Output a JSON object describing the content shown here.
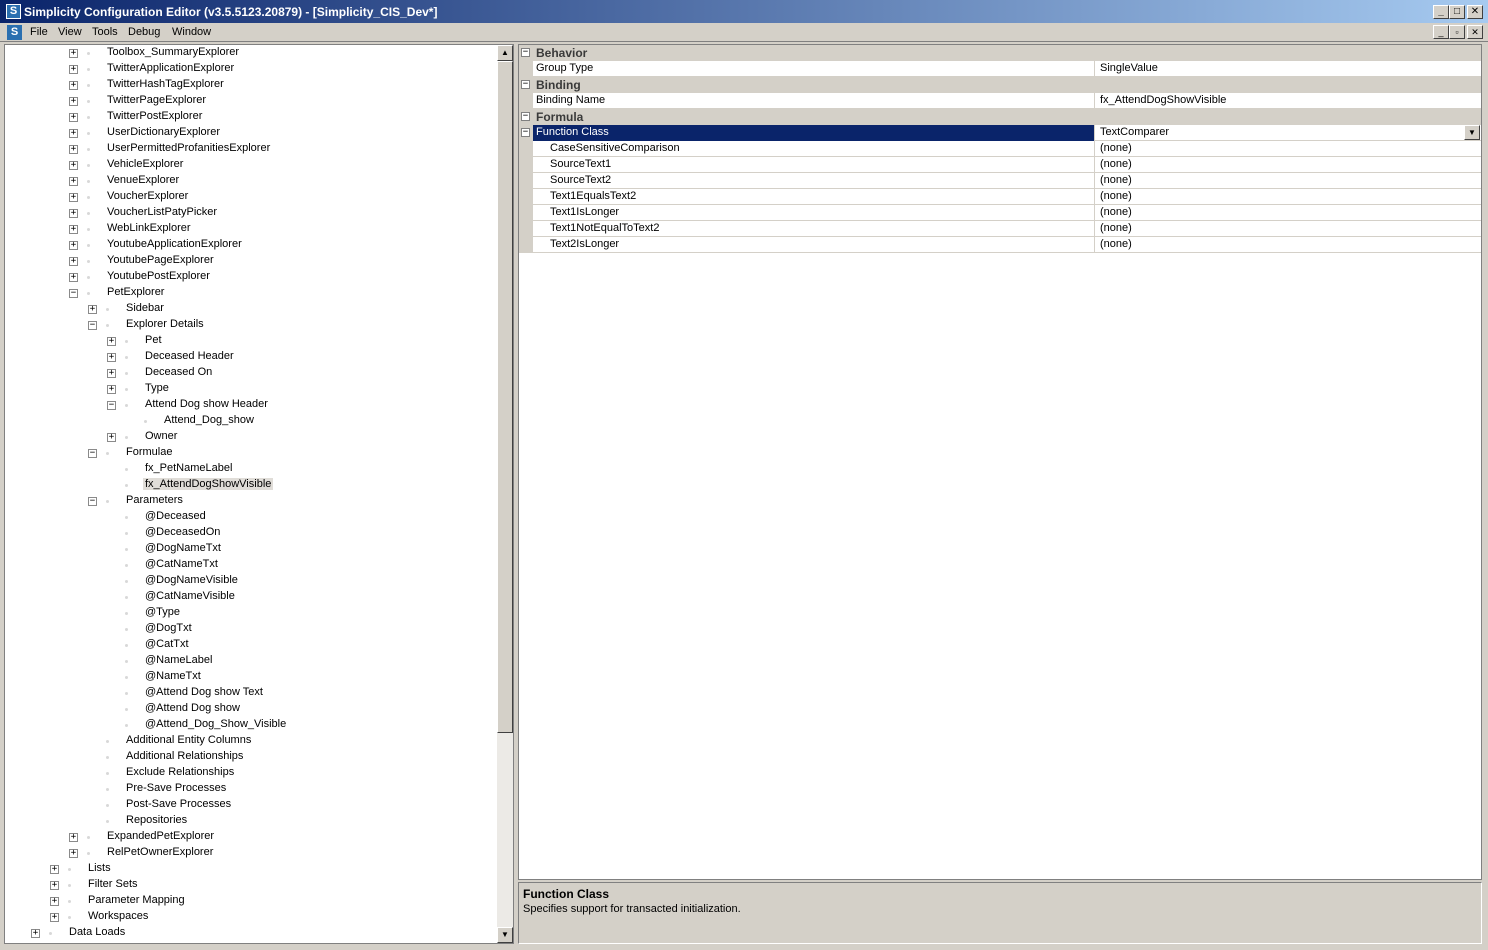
{
  "window": {
    "title": "Simplicity Configuration Editor (v3.5.5123.20879) - [Simplicity_CIS_Dev*]",
    "app_icon": "S",
    "buttons": {
      "minimize": "_",
      "maximize": "□",
      "close": "✕"
    }
  },
  "menu": {
    "doc_icon": "S",
    "items": [
      "File",
      "View",
      "Tools",
      "Debug",
      "Window"
    ],
    "mdi_buttons": {
      "minimize": "_",
      "restore": "▫",
      "close": "✕"
    }
  },
  "tree": {
    "rows": [
      {
        "label": "Toolbox_SummaryExplorer",
        "level": 2,
        "expander": "+"
      },
      {
        "label": "TwitterApplicationExplorer",
        "level": 2,
        "expander": "+"
      },
      {
        "label": "TwitterHashTagExplorer",
        "level": 2,
        "expander": "+"
      },
      {
        "label": "TwitterPageExplorer",
        "level": 2,
        "expander": "+"
      },
      {
        "label": "TwitterPostExplorer",
        "level": 2,
        "expander": "+"
      },
      {
        "label": "UserDictionaryExplorer",
        "level": 2,
        "expander": "+"
      },
      {
        "label": "UserPermittedProfanitiesExplorer",
        "level": 2,
        "expander": "+"
      },
      {
        "label": "VehicleExplorer",
        "level": 2,
        "expander": "+"
      },
      {
        "label": "VenueExplorer",
        "level": 2,
        "expander": "+"
      },
      {
        "label": "VoucherExplorer",
        "level": 2,
        "expander": "+"
      },
      {
        "label": "VoucherListPatyPicker",
        "level": 2,
        "expander": "+"
      },
      {
        "label": "WebLinkExplorer",
        "level": 2,
        "expander": "+"
      },
      {
        "label": "YoutubeApplicationExplorer",
        "level": 2,
        "expander": "+"
      },
      {
        "label": "YoutubePageExplorer",
        "level": 2,
        "expander": "+"
      },
      {
        "label": "YoutubePostExplorer",
        "level": 2,
        "expander": "+"
      },
      {
        "label": "PetExplorer",
        "level": 2,
        "expander": "−"
      },
      {
        "label": "Sidebar",
        "level": 3,
        "expander": "+"
      },
      {
        "label": "Explorer Details",
        "level": 3,
        "expander": "−"
      },
      {
        "label": "Pet",
        "level": 4,
        "expander": "+"
      },
      {
        "label": "Deceased Header",
        "level": 4,
        "expander": "+"
      },
      {
        "label": "Deceased On",
        "level": 4,
        "expander": "+"
      },
      {
        "label": "Type",
        "level": 4,
        "expander": "+"
      },
      {
        "label": "Attend Dog show Header",
        "level": 4,
        "expander": "−"
      },
      {
        "label": "Attend_Dog_show",
        "level": 5,
        "expander": ""
      },
      {
        "label": "Owner",
        "level": 4,
        "expander": "+"
      },
      {
        "label": "Formulae",
        "level": 3,
        "expander": "−"
      },
      {
        "label": "fx_PetNameLabel",
        "level": 4,
        "expander": ""
      },
      {
        "label": "fx_AttendDogShowVisible",
        "level": 4,
        "expander": "",
        "selected": true
      },
      {
        "label": "Parameters",
        "level": 3,
        "expander": "−"
      },
      {
        "label": "@Deceased",
        "level": 4,
        "expander": ""
      },
      {
        "label": "@DeceasedOn",
        "level": 4,
        "expander": ""
      },
      {
        "label": "@DogNameTxt",
        "level": 4,
        "expander": ""
      },
      {
        "label": "@CatNameTxt",
        "level": 4,
        "expander": ""
      },
      {
        "label": "@DogNameVisible",
        "level": 4,
        "expander": ""
      },
      {
        "label": "@CatNameVisible",
        "level": 4,
        "expander": ""
      },
      {
        "label": "@Type",
        "level": 4,
        "expander": ""
      },
      {
        "label": "@DogTxt",
        "level": 4,
        "expander": ""
      },
      {
        "label": "@CatTxt",
        "level": 4,
        "expander": ""
      },
      {
        "label": "@NameLabel",
        "level": 4,
        "expander": ""
      },
      {
        "label": "@NameTxt",
        "level": 4,
        "expander": ""
      },
      {
        "label": "@Attend Dog show Text",
        "level": 4,
        "expander": ""
      },
      {
        "label": "@Attend Dog show",
        "level": 4,
        "expander": ""
      },
      {
        "label": "@Attend_Dog_Show_Visible",
        "level": 4,
        "expander": ""
      },
      {
        "label": "Additional Entity Columns",
        "level": 3,
        "expander": ""
      },
      {
        "label": "Additional Relationships",
        "level": 3,
        "expander": ""
      },
      {
        "label": "Exclude Relationships",
        "level": 3,
        "expander": ""
      },
      {
        "label": "Pre-Save Processes",
        "level": 3,
        "expander": ""
      },
      {
        "label": "Post-Save Processes",
        "level": 3,
        "expander": ""
      },
      {
        "label": "Repositories",
        "level": 3,
        "expander": ""
      },
      {
        "label": "ExpandedPetExplorer",
        "level": 2,
        "expander": "+"
      },
      {
        "label": "RelPetOwnerExplorer",
        "level": 2,
        "expander": "+"
      },
      {
        "label": "Lists",
        "level": 1,
        "expander": "+"
      },
      {
        "label": "Filter Sets",
        "level": 1,
        "expander": "+"
      },
      {
        "label": "Parameter Mapping",
        "level": 1,
        "expander": "+"
      },
      {
        "label": "Workspaces",
        "level": 1,
        "expander": "+"
      },
      {
        "label": "Data Loads",
        "level": 0,
        "expander": "+"
      }
    ],
    "scroll": {
      "up": "▲",
      "down": "▼"
    }
  },
  "property_grid": {
    "toggles": {
      "category": "−",
      "sub": "−",
      "dropdown": "▼"
    },
    "categories": [
      {
        "label": "Behavior",
        "rows": [
          {
            "name": "Group Type",
            "value": "SingleValue"
          }
        ]
      },
      {
        "label": "Binding",
        "rows": [
          {
            "name": "Binding Name",
            "value": "fx_AttendDogShowVisible"
          }
        ]
      },
      {
        "label": "Formula",
        "rows": [
          {
            "name": "Function Class",
            "value": "TextComparer",
            "selected": true,
            "expandable": true,
            "dropdown": true
          },
          {
            "name": "CaseSensitiveComparison",
            "value": "(none)",
            "child": true
          },
          {
            "name": "SourceText1",
            "value": "(none)",
            "child": true
          },
          {
            "name": "SourceText2",
            "value": "(none)",
            "child": true
          },
          {
            "name": "Text1EqualsText2",
            "value": "(none)",
            "child": true
          },
          {
            "name": "Text1IsLonger",
            "value": "(none)",
            "child": true
          },
          {
            "name": "Text1NotEqualToText2",
            "value": "(none)",
            "child": true
          },
          {
            "name": "Text2IsLonger",
            "value": "(none)",
            "child": true
          }
        ]
      }
    ]
  },
  "description": {
    "title": "Function Class",
    "text": "Specifies support for transacted initialization."
  }
}
